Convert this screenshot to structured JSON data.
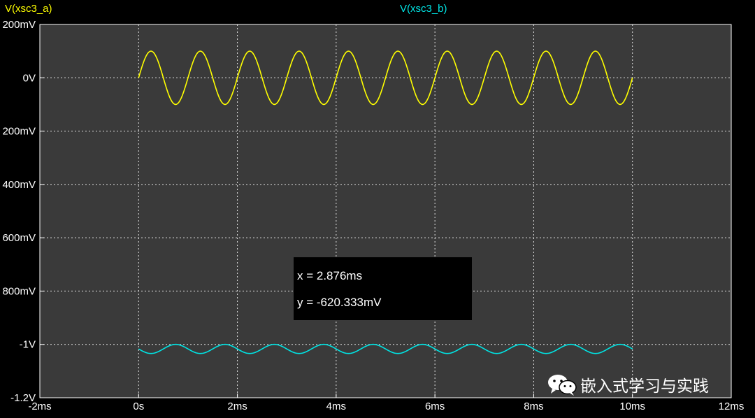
{
  "chart_data": {
    "type": "line",
    "xlim": [
      -2,
      12
    ],
    "ylim": [
      -1200,
      200
    ],
    "x_ticks": [
      -2,
      0,
      2,
      4,
      6,
      8,
      10,
      12
    ],
    "x_tick_labels": [
      "-2ms",
      "0s",
      "2ms",
      "4ms",
      "6ms",
      "8ms",
      "10ms",
      "12ms"
    ],
    "y_ticks": [
      200,
      0,
      -200,
      -400,
      -600,
      -800,
      -1000,
      -1200
    ],
    "y_tick_labels": [
      "200mV",
      "0V",
      "200mV",
      "400mV",
      "600mV",
      "800mV",
      "-1V",
      "-1.2V"
    ],
    "grid": true,
    "legend": "top",
    "series": [
      {
        "name": "V(xsc3_a)",
        "color": "#ffff00",
        "waveform": "sine",
        "x_start": 0,
        "x_end": 10,
        "offset": 0,
        "amplitude": 100,
        "frequency_khz": 1,
        "phase_deg": 0
      },
      {
        "name": "V(xsc3_b)",
        "color": "#00e5e5",
        "waveform": "sine",
        "x_start": 0,
        "x_end": 10,
        "offset": -1017,
        "amplitude": 17,
        "frequency_khz": 1,
        "phase_deg": 180
      }
    ]
  },
  "tooltip": {
    "x_text": "x = 2.876ms",
    "y_text": "y = -620.333mV"
  },
  "watermark": {
    "text": "嵌入式学习与实践",
    "icon": "wechat-icon"
  },
  "colors": {
    "plot_background": "#3a3a3a",
    "frame": "#ffffff",
    "grid": "#ffffff",
    "page_background": "#000000"
  }
}
